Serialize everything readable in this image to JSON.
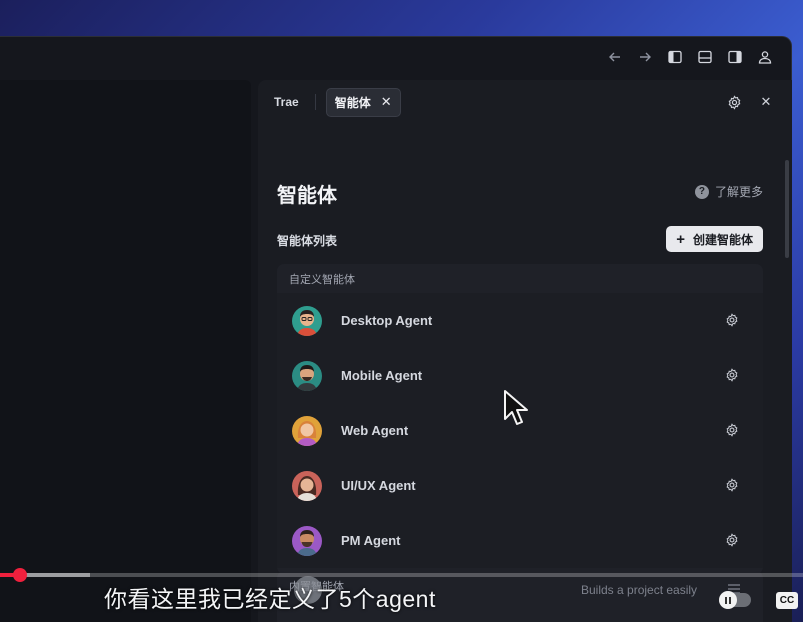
{
  "titlebar": {
    "icons": [
      "arrow-left-icon",
      "arrow-right-icon",
      "layout-left-icon",
      "layout-bottom-icon",
      "layout-right-icon",
      "user-icon"
    ]
  },
  "panel": {
    "tabs": [
      {
        "label": "Trae"
      },
      {
        "label": "智能体",
        "active": true
      }
    ],
    "title": "智能体",
    "learn_more": "了解更多",
    "list_title": "智能体列表",
    "create_button": "创建智能体",
    "custom_group": {
      "label": "自定义智能体",
      "agents": [
        {
          "name": "Desktop Agent",
          "avatar_color": "#2f9e8f"
        },
        {
          "name": "Mobile Agent",
          "avatar_color": "#2b8c83"
        },
        {
          "name": "Web Agent",
          "avatar_color": "#e0a23a"
        },
        {
          "name": "UI/UX Agent",
          "avatar_color": "#c9635a"
        },
        {
          "name": "PM Agent",
          "avatar_color": "#9b59c6"
        }
      ]
    },
    "builtin_group": {
      "label": "内置智能体"
    }
  },
  "video": {
    "subtitle": "你看这里我已经定义了5个agent",
    "background_hint": "Builds a project easily",
    "cc_label": "CC"
  },
  "colors": {
    "accent_progress": "#f0203d",
    "panel_bg": "#1a1c22"
  }
}
